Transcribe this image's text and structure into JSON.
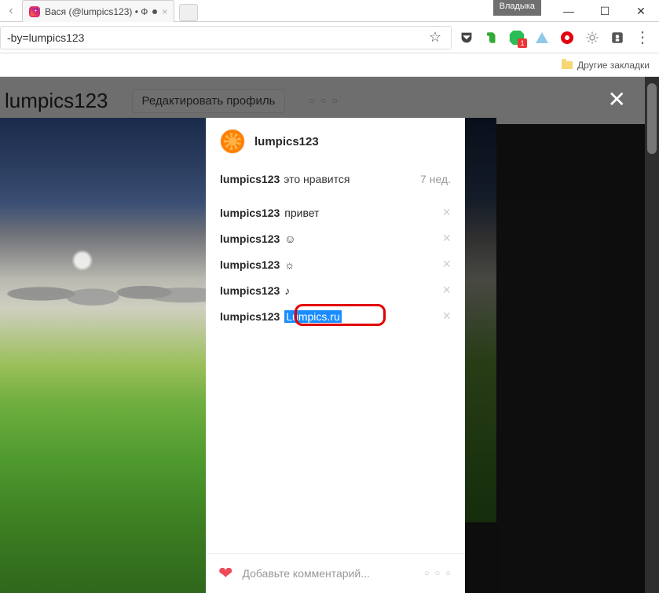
{
  "window": {
    "badge": "Владыка",
    "minimize": "—",
    "maximize": "☐",
    "close": "✕"
  },
  "tab": {
    "title": "Вася (@lumpics123) • Ф",
    "close": "×"
  },
  "address": {
    "text": "-by=lumpics123",
    "star": "☆"
  },
  "toolbar": {
    "adblock_badge": "1"
  },
  "bookmarks": {
    "other": "Другие закладки"
  },
  "profile": {
    "username_prefix": "lumpics123",
    "edit_label": "Редактировать профиль",
    "options": "○ ○ ○"
  },
  "modal": {
    "close": "✕",
    "author": "lumpics123",
    "likes_user": "lumpics123",
    "likes_text": "это нравится",
    "time": "7 нед.",
    "comments": [
      {
        "user": "lumpics123",
        "text": "привет"
      },
      {
        "user": "lumpics123",
        "text": "☺"
      },
      {
        "user": "lumpics123",
        "text": "☼"
      },
      {
        "user": "lumpics123",
        "text": "♪"
      },
      {
        "user": "lumpics123",
        "text_selected": "Lumpics.ru"
      }
    ],
    "delete": "×",
    "add_comment_placeholder": "Добавьте комментарий...",
    "more": "○ ○ ○"
  }
}
